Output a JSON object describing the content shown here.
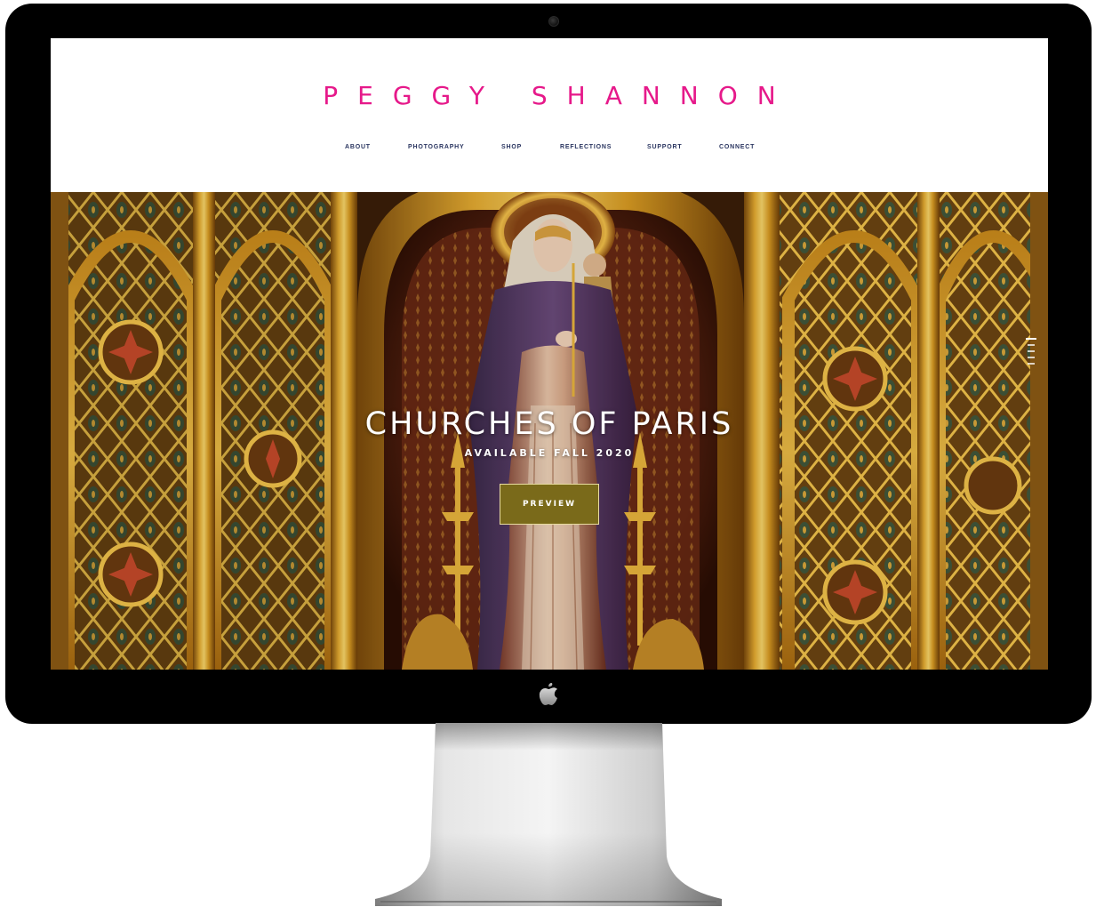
{
  "site": {
    "title": "PEGGY SHANNON",
    "title_color": "#e6198a",
    "nav": [
      {
        "label": "ABOUT"
      },
      {
        "label": "PHOTOGRAPHY"
      },
      {
        "label": "SHOP"
      },
      {
        "label": "REFLECTIONS"
      },
      {
        "label": "SUPPORT"
      },
      {
        "label": "CONNECT"
      }
    ],
    "nav_color": "#2a3560"
  },
  "hero": {
    "title": "CHURCHES OF PARIS",
    "subtitle": "AVAILABLE FALL 2020",
    "button_label": "PREVIEW",
    "button_color": "#7a6a1a",
    "slide_count": 3,
    "active_slide": 1
  },
  "icons": {
    "logo": "apple-logo-icon",
    "camera": "camera-icon"
  }
}
